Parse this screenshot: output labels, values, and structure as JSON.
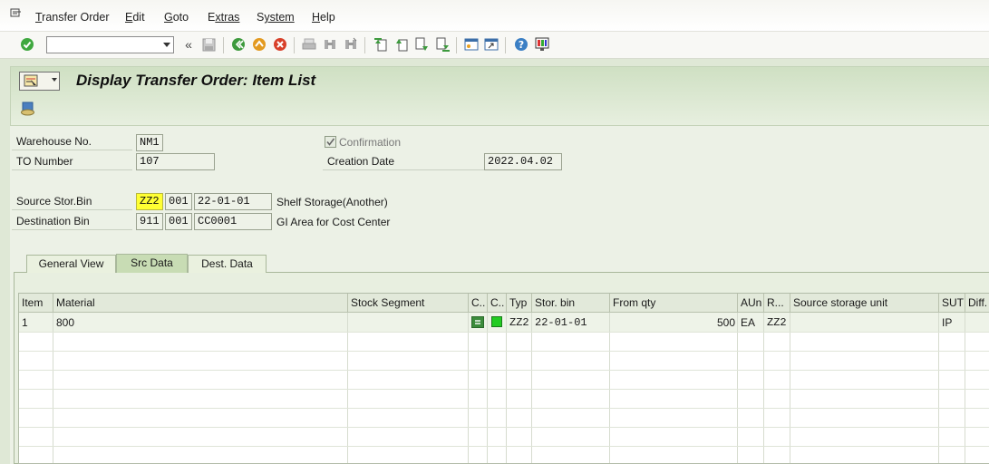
{
  "menubar": {
    "items": [
      {
        "label": "Transfer Order",
        "ul": "T",
        "rest": "ransfer Order"
      },
      {
        "label": "Edit",
        "ul": "E",
        "rest": "dit"
      },
      {
        "label": "Goto",
        "ul": "G",
        "rest": "oto"
      },
      {
        "label": "Extras",
        "ul": "E",
        "rest": "xtras",
        "full_underline": false
      },
      {
        "label": "System",
        "ul": "S",
        "rest": "ystem"
      },
      {
        "label": "Help",
        "ul": "H",
        "rest": "elp"
      }
    ]
  },
  "toolbar": {
    "command_field": "",
    "icons": [
      "enter-icon",
      "command-field",
      "back-arrows-icon",
      "save-icon",
      "back-icon",
      "exit-icon",
      "cancel-icon",
      "print-icon",
      "find-icon",
      "find-next-icon",
      "first-page-icon",
      "previous-page-icon",
      "next-page-icon",
      "last-page-icon",
      "create-session-icon",
      "shortcut-icon",
      "help-icon",
      "customize-layout-icon"
    ]
  },
  "page": {
    "title": "Display Transfer Order: Item List"
  },
  "header": {
    "warehouse_label": "Warehouse No.",
    "warehouse_value": "NM1",
    "to_number_label": "TO Number",
    "to_number_value": "107",
    "confirmation_label": "Confirmation",
    "confirmation_checked": true,
    "creation_date_label": "Creation Date",
    "creation_date_value": "2022.04.02",
    "source_bin_label": "Source Stor.Bin",
    "source_type": "ZZ2",
    "source_section": "001",
    "source_bin": "22-01-01",
    "source_desc": "Shelf Storage(Another)",
    "dest_bin_label": "Destination Bin",
    "dest_type": "911",
    "dest_section": "001",
    "dest_bin": "CC0001",
    "dest_desc": "GI Area for Cost Center"
  },
  "tabs": [
    {
      "label": "General View",
      "active": false
    },
    {
      "label": "Src Data",
      "active": true
    },
    {
      "label": "Dest. Data",
      "active": false
    }
  ],
  "table": {
    "columns": [
      "Item",
      "Material",
      "Stock Segment",
      "C..",
      "C..",
      "Typ",
      "Stor. bin",
      "From qty",
      "AUn",
      "R...",
      "Source storage unit",
      "SUT",
      "Diff."
    ],
    "rows": [
      {
        "item": "1",
        "material": "800",
        "stock_segment": "",
        "c1_icon": "equal-status-icon",
        "c2_icon": "green-light-icon",
        "typ": "ZZ2",
        "stor_bin": "22-01-01",
        "from_qty": "500",
        "aun": "EA",
        "r": "ZZ2",
        "source_su": "",
        "sut": "IP",
        "diff": ""
      }
    ]
  },
  "colors": {
    "highlight": "#ffff33",
    "status_green": "#22cc22",
    "title_band": "#d6e4ca"
  }
}
